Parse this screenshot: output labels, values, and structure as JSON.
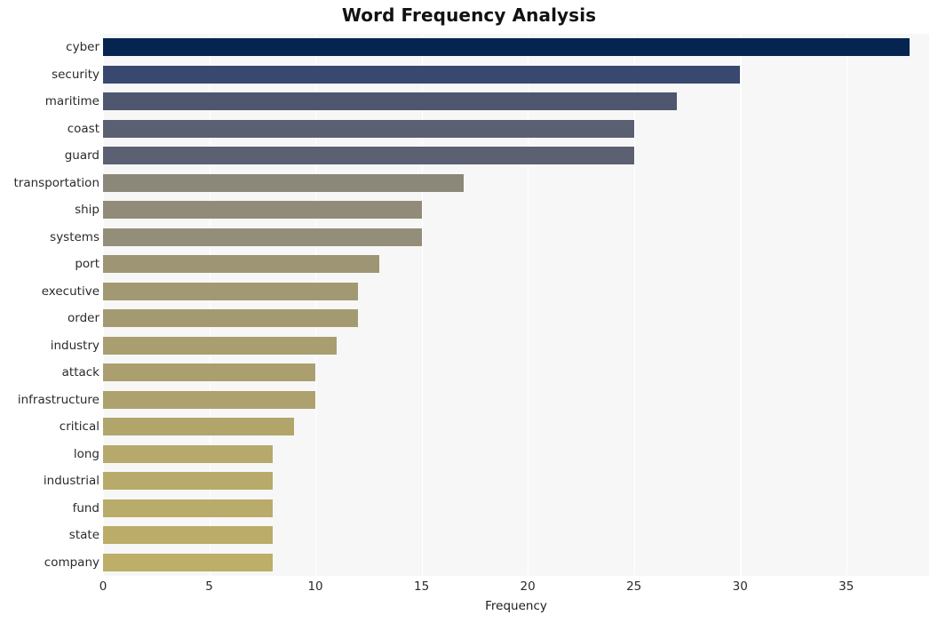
{
  "chart_data": {
    "type": "bar",
    "orientation": "horizontal",
    "title": "Word Frequency Analysis",
    "xlabel": "Frequency",
    "ylabel": "",
    "categories": [
      "cyber",
      "security",
      "maritime",
      "coast",
      "guard",
      "transportation",
      "ship",
      "systems",
      "port",
      "executive",
      "order",
      "industry",
      "attack",
      "infrastructure",
      "critical",
      "long",
      "industrial",
      "fund",
      "state",
      "company"
    ],
    "values": [
      38,
      30,
      27,
      25,
      25,
      17,
      15,
      15,
      13,
      12,
      12,
      11,
      10,
      10,
      9,
      8,
      8,
      8,
      8,
      8
    ],
    "bar_colors": [
      "#052450",
      "#39486e",
      "#4e5670",
      "#5a5f72",
      "#5b6073",
      "#8b8779",
      "#918c79",
      "#938e79",
      "#9d9573",
      "#a29972",
      "#a39a72",
      "#a89e70",
      "#ab9f6f",
      "#ada16e",
      "#b1a56c",
      "#b6a96b",
      "#b8aa6a",
      "#b9ab6a",
      "#bbac69",
      "#bdae68"
    ],
    "xlim": [
      0,
      38.9
    ],
    "ylim_categories": 20,
    "xticks": [
      0,
      5,
      10,
      15,
      20,
      25,
      30,
      35
    ],
    "xtick_labels": [
      "0",
      "5",
      "10",
      "15",
      "20",
      "25",
      "30",
      "35"
    ],
    "grid": true,
    "grid_axis": "x",
    "grid_color": "#ffffff",
    "plot_background": "#f7f7f7",
    "figure_background": "#ffffff",
    "legend": null,
    "title_color": "#121212",
    "tick_label_color": "#2b2b2b"
  }
}
